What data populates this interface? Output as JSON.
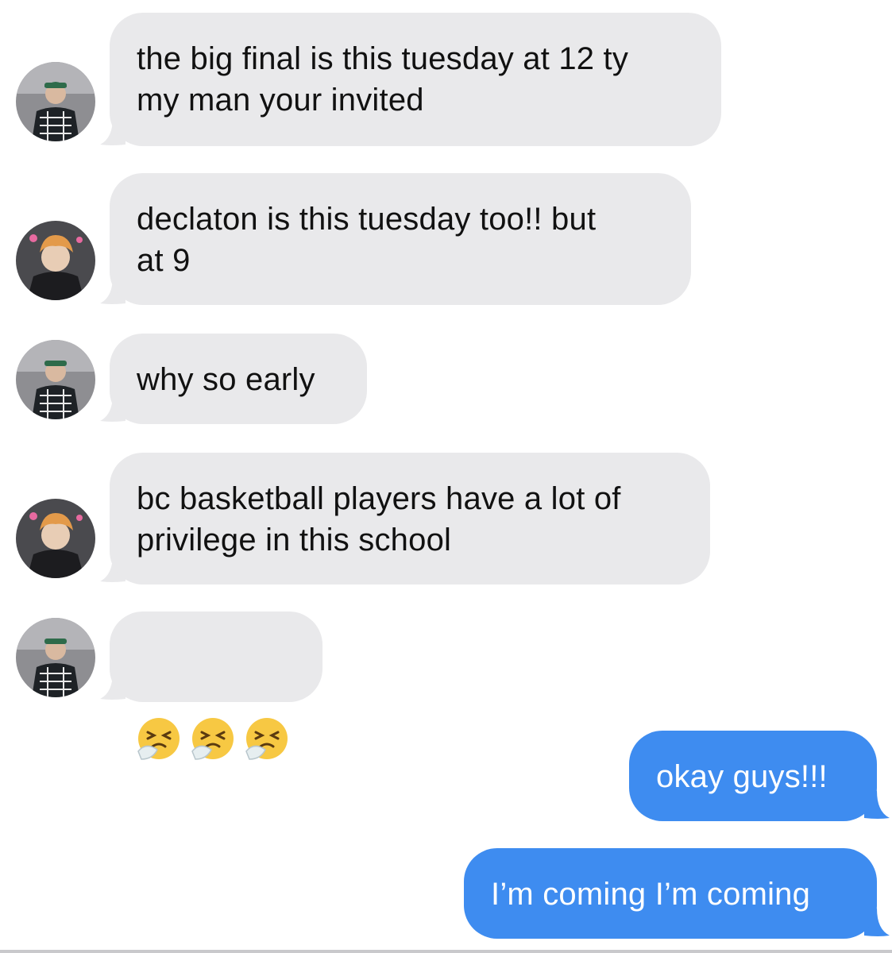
{
  "conversation": {
    "messages": [
      {
        "sender": "incoming",
        "avatar": "avatar-green-cap-person",
        "text": "the big final is this tuesday at 12 ty\nmy man your invited"
      },
      {
        "sender": "incoming",
        "avatar": "avatar-orange-hair-person",
        "text": "declaton is this tuesday too!! but\nat 9"
      },
      {
        "sender": "incoming",
        "avatar": "avatar-green-cap-person",
        "text": "why so early"
      },
      {
        "sender": "incoming",
        "avatar": "avatar-orange-hair-person",
        "text": "bc basketball players have a lot of\nprivilege in this school"
      },
      {
        "sender": "incoming",
        "avatar": "avatar-green-cap-person",
        "emojis": [
          "sneezing-face-emoji",
          "sneezing-face-emoji",
          "sneezing-face-emoji"
        ]
      },
      {
        "sender": "outgoing",
        "text": "okay guys!!!"
      },
      {
        "sender": "outgoing",
        "text": "I’m coming I’m coming"
      }
    ]
  },
  "colors": {
    "incoming_bubble": "#e9e9eb",
    "outgoing_bubble": "#3e8cf0",
    "incoming_text": "#111111",
    "outgoing_text": "#ffffff"
  }
}
